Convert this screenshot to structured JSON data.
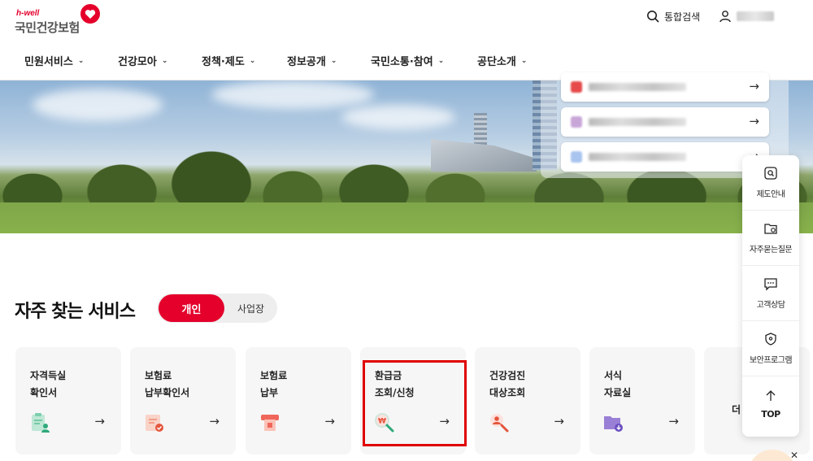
{
  "header": {
    "logo_sub": "h-well",
    "logo_main": "국민건강보험",
    "search_label": "통합검색",
    "user_label": ""
  },
  "gnb": [
    {
      "label": "민원서비스"
    },
    {
      "label": "건강모아"
    },
    {
      "label": "정책·제도"
    },
    {
      "label": "정보공개"
    },
    {
      "label": "국민소통·참여"
    },
    {
      "label": "공단소개"
    }
  ],
  "float_menu": [
    {
      "label": "제도안내",
      "icon": "document-search-icon"
    },
    {
      "label": "자주묻는질문",
      "icon": "folder-question-icon"
    },
    {
      "label": "고객상담",
      "icon": "chat-bubble-icon"
    },
    {
      "label": "보안프로그램",
      "icon": "shield-lock-icon"
    },
    {
      "label": "TOP",
      "icon": "arrow-up-icon"
    }
  ],
  "services": {
    "title": "자주 찾는 서비스",
    "tab_personal": "개인",
    "tab_business": "사업장",
    "cards": [
      {
        "line1": "자격득실",
        "line2": "확인서",
        "icon": "clipboard-person-icon"
      },
      {
        "line1": "보험료",
        "line2": "납부확인서",
        "icon": "receipt-check-icon"
      },
      {
        "line1": "보험료",
        "line2": "납부",
        "icon": "card-payment-icon"
      },
      {
        "line1": "환급금",
        "line2": "조회/신청",
        "icon": "won-magnifier-icon"
      },
      {
        "line1": "건강검진",
        "line2": "대상조회",
        "icon": "person-search-icon"
      },
      {
        "line1": "서식",
        "line2": "자료실",
        "icon": "folder-download-icon"
      }
    ],
    "partial_card_text": "더"
  },
  "colors": {
    "brand_red": "#e4002b",
    "highlight_red": "#e00000"
  }
}
